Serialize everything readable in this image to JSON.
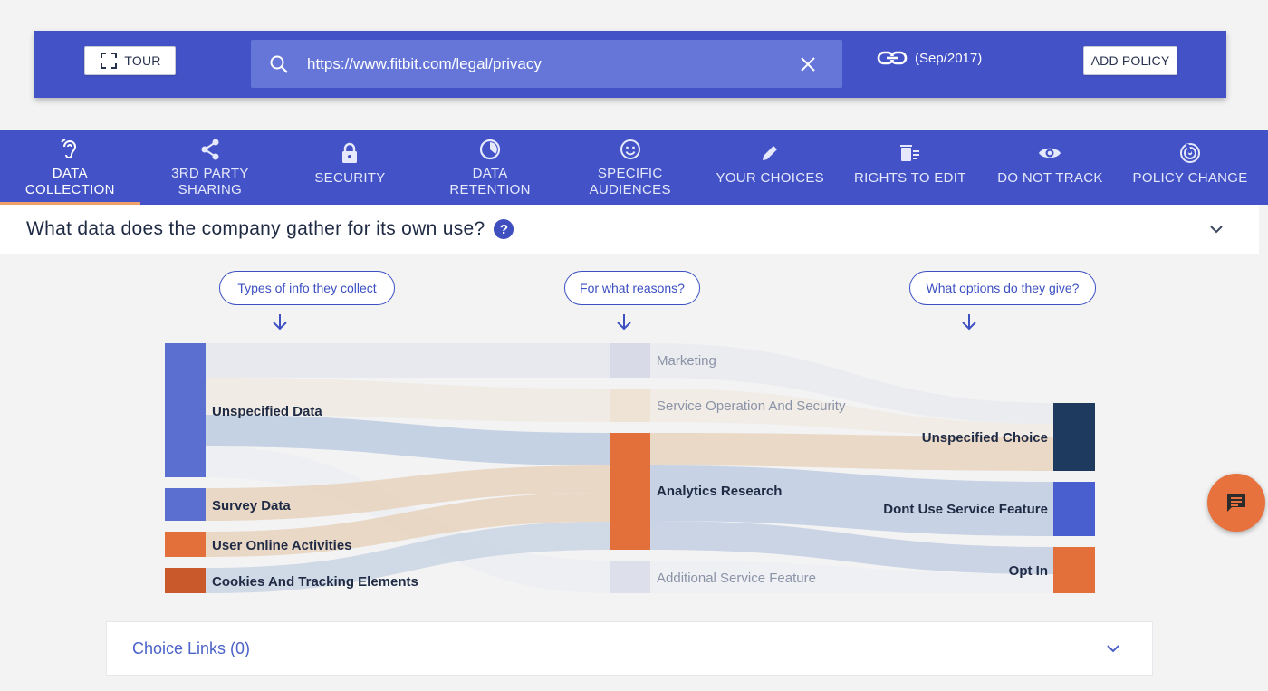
{
  "toolbar": {
    "tour_label": "TOUR",
    "url_value": "https://www.fitbit.com/legal/privacy",
    "policy_date": "(Sep/2017)",
    "add_policy_label": "ADD POLICY"
  },
  "tabs": [
    {
      "label": "DATA\nCOLLECTION",
      "icon": "ear-icon",
      "active": true
    },
    {
      "label": "3RD PARTY\nSHARING",
      "icon": "share-icon",
      "active": false
    },
    {
      "label": "SECURITY",
      "icon": "lock-icon",
      "active": false
    },
    {
      "label": "DATA\nRETENTION",
      "icon": "timer-icon",
      "active": false
    },
    {
      "label": "SPECIFIC\nAUDIENCES",
      "icon": "face-icon",
      "active": false
    },
    {
      "label": "YOUR CHOICES",
      "icon": "pencil-icon",
      "active": false
    },
    {
      "label": "RIGHTS TO EDIT",
      "icon": "delete-edit-icon",
      "active": false
    },
    {
      "label": "DO NOT TRACK",
      "icon": "eye-icon",
      "active": false
    },
    {
      "label": "POLICY CHANGE",
      "icon": "radar-icon",
      "active": false
    }
  ],
  "question": {
    "text": "What data does the company gather for its own use?",
    "help_symbol": "?"
  },
  "sankey": {
    "headers": [
      "Types of info they collect",
      "For what reasons?",
      "What options do they give?"
    ],
    "sources": [
      {
        "label": "Unspecified Data",
        "color": "#5b6fd0",
        "weight": 3
      },
      {
        "label": "Survey Data",
        "color": "#5b6fd0",
        "weight": 1
      },
      {
        "label": "User Online Activities",
        "color": "#e36f3b",
        "weight": 1
      },
      {
        "label": "Cookies And Tracking Elements",
        "color": "#c9582b",
        "weight": 1
      }
    ],
    "purposes": [
      {
        "label": "Marketing",
        "color": "#d8dbe7",
        "highlight": false,
        "weight": 1
      },
      {
        "label": "Service Operation And Security",
        "color": "#efe3d6",
        "highlight": false,
        "weight": 1
      },
      {
        "label": "Analytics Research",
        "color": "#e36f3b",
        "highlight": true,
        "weight": 4
      },
      {
        "label": "Additional Service Feature",
        "color": "#dde0ea",
        "highlight": false,
        "weight": 1
      }
    ],
    "choices": [
      {
        "label": "Unspecified Choice",
        "color": "#1e3a5f",
        "weight": 3
      },
      {
        "label": "Dont Use Service Feature",
        "color": "#4a5fcf",
        "weight": 2
      },
      {
        "label": "Opt In",
        "color": "#e36f3b",
        "weight": 2
      }
    ]
  },
  "choice_links": {
    "label": "Choice Links (0)"
  },
  "colors": {
    "brand": "#4353c7",
    "accent": "#e8723e"
  }
}
